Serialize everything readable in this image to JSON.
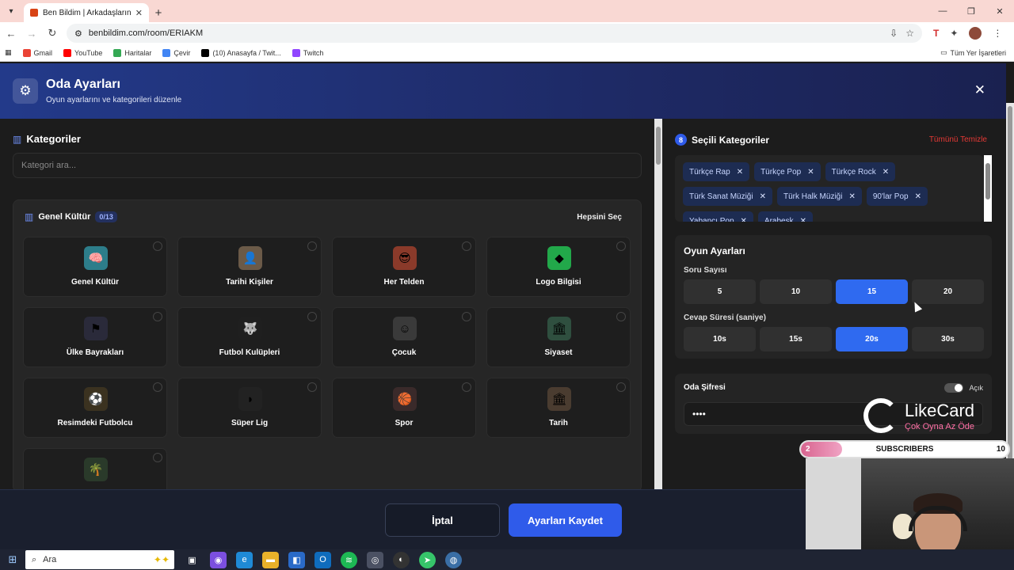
{
  "browser": {
    "tab_title": "Ben Bildim | Arkadaşlarınla Onl",
    "url": "benbildim.com/room/ERIAKM",
    "bookmarks": [
      {
        "label": "Gmail",
        "color": "#ea4335"
      },
      {
        "label": "YouTube",
        "color": "#ff0000"
      },
      {
        "label": "Haritalar",
        "color": "#34a853"
      },
      {
        "label": "Çevir",
        "color": "#4285f4"
      },
      {
        "label": "(10) Anasayfa / Twit...",
        "color": "#000000"
      },
      {
        "label": "Twitch",
        "color": "#9146ff"
      }
    ],
    "bookmarks_right": "Tüm Yer İşaretleri"
  },
  "header": {
    "title": "Oda Ayarları",
    "subtitle": "Oyun ayarlarını ve kategorileri düzenle"
  },
  "categories": {
    "title": "Kategoriler",
    "search_placeholder": "Kategori ara...",
    "group": {
      "name": "Genel Kültür",
      "count": "0/13",
      "select_all": "Hepsini Seç",
      "items": [
        {
          "label": "Genel Kültür",
          "icon": "🧠",
          "bg": "#2d7d8a"
        },
        {
          "label": "Tarihi Kişiler",
          "icon": "👤",
          "bg": "#6b5a48"
        },
        {
          "label": "Her Telden",
          "icon": "😎",
          "bg": "#8a3a2a"
        },
        {
          "label": "Logo Bilgisi",
          "icon": "◆",
          "bg": "#22a84a"
        },
        {
          "label": "Ülke Bayrakları",
          "icon": "⚑",
          "bg": "#2a2a3a"
        },
        {
          "label": "Futbol Kulüpleri",
          "icon": "🐺",
          "bg": "#1f1f1f"
        },
        {
          "label": "Çocuk",
          "icon": "☺",
          "bg": "#3a3a3a"
        },
        {
          "label": "Siyaset",
          "icon": "🏛",
          "bg": "#2f4f3f"
        },
        {
          "label": "Resimdeki Futbolcu",
          "icon": "⚽",
          "bg": "#3b3220"
        },
        {
          "label": "Süper Lig",
          "icon": "◗",
          "bg": "#222"
        },
        {
          "label": "Spor",
          "icon": "🏀",
          "bg": "#3a2a2a"
        },
        {
          "label": "Tarih",
          "icon": "🏛",
          "bg": "#4a3c30"
        },
        {
          "label": "",
          "icon": "🌴",
          "bg": "#2a3a2a"
        }
      ]
    }
  },
  "selected": {
    "count": "8",
    "title": "Seçili Kategoriler",
    "clear_all": "Tümünü Temizle",
    "chips": [
      "Türkçe Rap",
      "Türkçe Pop",
      "Türkçe Rock",
      "Türk Sanat Müziği",
      "Türk Halk Müziği",
      "90'lar Pop",
      "Yabancı Pop",
      "Arabesk"
    ]
  },
  "game_settings": {
    "title": "Oyun Ayarları",
    "question_count_label": "Soru Sayısı",
    "question_counts": [
      "5",
      "10",
      "15",
      "20"
    ],
    "question_count_selected": "15",
    "answer_time_label": "Cevap Süresi (saniye)",
    "answer_times": [
      "10s",
      "15s",
      "20s",
      "30s"
    ],
    "answer_time_selected": "20s"
  },
  "room_password": {
    "title": "Oda Şifresi",
    "toggle_label": "Açık",
    "value": "••••"
  },
  "footer": {
    "cancel_label": "İptal",
    "save_label": "Ayarları Kaydet"
  },
  "overlay": {
    "brand": "LikeCard",
    "tagline": "Çok Oyna  Az Öde",
    "subscribers_label": "SUBSCRIBERS",
    "sub_current": "2",
    "sub_goal": "10",
    "sub_progress": 0.2
  },
  "taskbar": {
    "search_placeholder": "Ara"
  }
}
